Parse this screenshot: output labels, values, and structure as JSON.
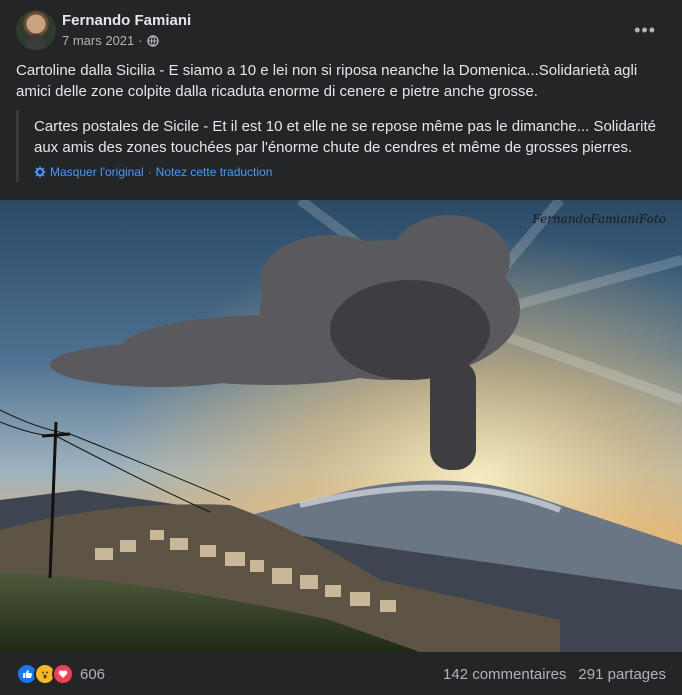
{
  "post": {
    "author": "Fernando Famiani",
    "date": "7 mars 2021",
    "separator": "·",
    "more_icon": "more-horizontal-icon",
    "privacy_icon": "globe-icon",
    "text": "Cartoline dalla Sicilia - E siamo a 10 e lei non si riposa neanche la Domenica...Solidarietà agli amici delle zone colpite dalla ricaduta enorme di cenere e pietre anche grosse.",
    "translation": {
      "text": "Cartes postales de Sicile - Et il est 10 et elle ne se repose même pas le dimanche... Solidarité aux amis des zones touchées par l'énorme chute de cendres et même de grosses pierres.",
      "hide_original": "Masquer l'original",
      "rate": "Notez cette traduction",
      "sep": "·"
    },
    "photo": {
      "watermark": "FernandoFamianiFoto"
    },
    "reactions": {
      "count": "606",
      "icons": [
        "like-icon",
        "wow-icon",
        "love-icon"
      ],
      "colors": {
        "like": "#1877f2",
        "wow": "#f7b928",
        "love": "#f33e58"
      }
    },
    "stats": {
      "comments": "142 commentaires",
      "shares": "291 partages"
    }
  }
}
